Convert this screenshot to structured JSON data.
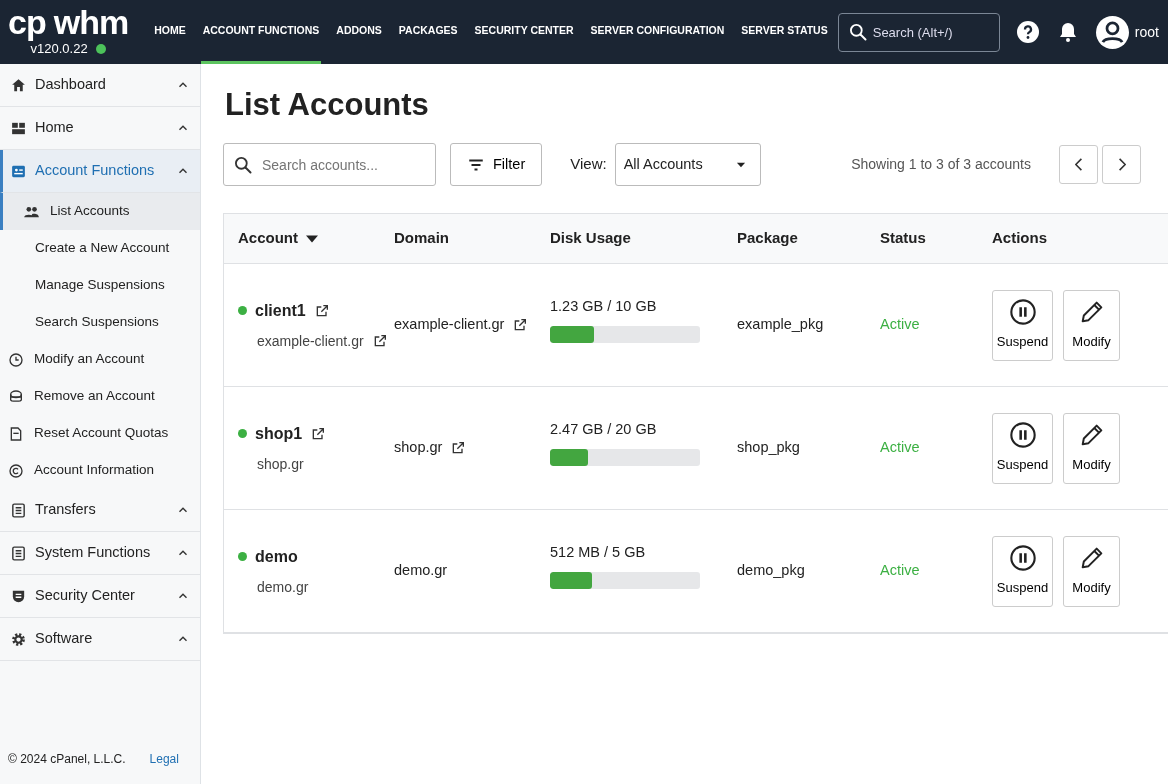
{
  "brand": {
    "logo": "cp",
    "name": "whm",
    "version": "v120.0.22",
    "online": true
  },
  "nav": [
    {
      "label": "HOME",
      "selected": false
    },
    {
      "label": "ACCOUNT FUNCTIONS",
      "selected": true
    },
    {
      "label": "ADDONS",
      "selected": false
    },
    {
      "label": "PACKAGES",
      "selected": false
    },
    {
      "label": "SECURITY CENTER",
      "selected": false
    },
    {
      "label": "SERVER CONFIGURATION",
      "selected": false
    },
    {
      "label": "SERVER STATUS",
      "selected": false
    }
  ],
  "global_search": {
    "placeholder": "Search (Alt+/)"
  },
  "user": {
    "name": "root"
  },
  "sidebar": {
    "items": [
      {
        "label": "Dashboard",
        "expanded": true,
        "selected": false
      },
      {
        "label": "Home",
        "expanded": true,
        "selected": false
      },
      {
        "label": "Account Functions",
        "expanded": true,
        "selected": true,
        "children": [
          {
            "label": "List Accounts",
            "selected": true
          },
          {
            "label": "Create a New Account",
            "selected": false
          },
          {
            "label": "Manage Suspensions",
            "selected": false
          },
          {
            "label": "Search Suspensions",
            "selected": false
          },
          {
            "label": "Modify an Account",
            "selected": false
          },
          {
            "label": "Remove an Account",
            "selected": false
          },
          {
            "label": "Reset Account Quotas",
            "selected": false
          },
          {
            "label": "Account Information",
            "selected": false
          }
        ]
      },
      {
        "label": "Transfers",
        "expanded": true,
        "selected": false
      },
      {
        "label": "System Functions",
        "expanded": true,
        "selected": false
      },
      {
        "label": "Security Center",
        "expanded": true,
        "selected": false
      },
      {
        "label": "Software",
        "expanded": true,
        "selected": false
      }
    ],
    "footer": {
      "copyright": "© 2024 cPanel, L.L.C.",
      "link": "Legal"
    }
  },
  "page": {
    "title": "List Accounts",
    "search": {
      "placeholder": "Search accounts..."
    },
    "filter_button": "Filter",
    "view": {
      "label": "View:",
      "value": "All Accounts"
    },
    "showing": "Showing 1 to 3 of 3 accounts"
  },
  "table": {
    "columns": [
      {
        "label": "Account",
        "sorted": true
      },
      {
        "label": "Domain",
        "sorted": false
      },
      {
        "label": "Disk Usage",
        "sorted": false
      },
      {
        "label": "Package",
        "sorted": false
      },
      {
        "label": "Status",
        "sorted": false
      },
      {
        "label": "Actions",
        "sorted": false
      }
    ],
    "rows": [
      {
        "account": "client1",
        "account_link": true,
        "subdomain": "example-client.gr",
        "subdomain_link": true,
        "domain": "example-client.gr",
        "domain_link": true,
        "disk": "1.23 GB / 10 GB",
        "level": 0.29,
        "package": "example_pkg",
        "status": "Active",
        "color": "#3cb043",
        "actions": [
          "Suspend",
          "Modify"
        ]
      },
      {
        "account": "shop1",
        "account_link": true,
        "subdomain": "shop.gr",
        "subdomain_link": false,
        "domain": "shop.gr",
        "domain_link": true,
        "disk": "2.47 GB / 20 GB",
        "level": 0.25,
        "package": "shop_pkg",
        "status": "Active",
        "color": "#3cb043",
        "actions": [
          "Suspend",
          "Modify"
        ]
      },
      {
        "account": "demo",
        "account_link": false,
        "subdomain": "demo.gr",
        "subdomain_link": false,
        "domain": "demo.gr",
        "domain_link": false,
        "disk": "512 MB / 5 GB",
        "level": 0.28,
        "package": "demo_pkg",
        "status": "Active",
        "color": "#3cb043",
        "actions": [
          "Suspend",
          "Modify"
        ]
      }
    ]
  }
}
